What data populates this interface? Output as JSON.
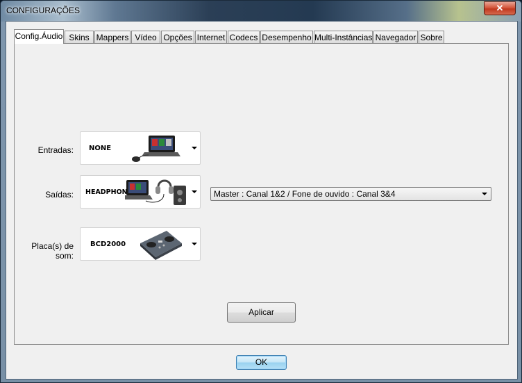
{
  "window": {
    "title": "CONFIGURAÇÕES",
    "close_label": "✕"
  },
  "tabs": [
    {
      "label": "Config.Áudio",
      "active": true
    },
    {
      "label": "Skins"
    },
    {
      "label": "Mappers"
    },
    {
      "label": "Vídeo"
    },
    {
      "label": "Opções"
    },
    {
      "label": "Internet"
    },
    {
      "label": "Codecs"
    },
    {
      "label": "Desempenho"
    },
    {
      "label": "Multi-Instâncias"
    },
    {
      "label": "Navegador"
    },
    {
      "label": "Sobre"
    }
  ],
  "audio": {
    "inputs_label": "Entradas:",
    "inputs_device": "NONE",
    "outputs_label": "Saídas:",
    "outputs_device": "HEADPHONES",
    "soundcard_label": "Placa(s) de som:",
    "soundcard_device": "BCD2000",
    "routing_selected": "Master : Canal 1&2 / Fone de ouvido : Canal 3&4",
    "apply_label": "Aplicar"
  },
  "footer": {
    "ok_label": "OK"
  },
  "icons": [
    "laptop-mouse-icon",
    "laptop-headphones-speaker-icon",
    "dj-controller-icon",
    "dropdown-caret-icon"
  ]
}
